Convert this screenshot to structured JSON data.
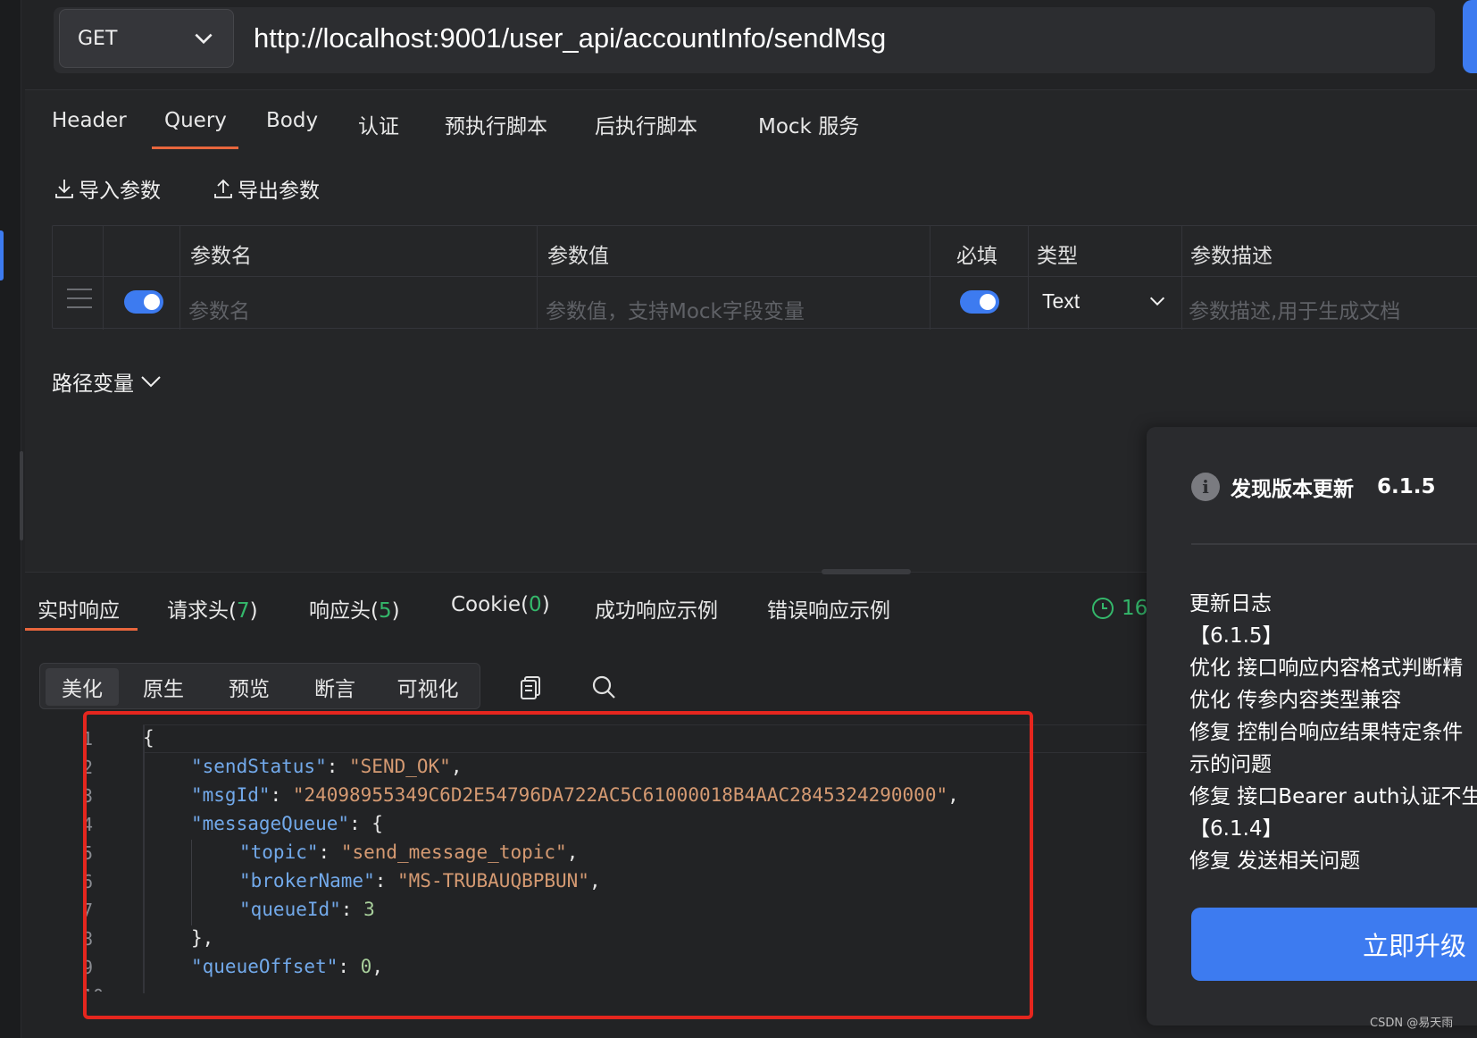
{
  "request": {
    "method": "GET",
    "url": "http://localhost:9001/user_api/accountInfo/sendMsg"
  },
  "request_tabs": [
    {
      "label": "Header"
    },
    {
      "label": "Query",
      "active": true
    },
    {
      "label": "Body"
    },
    {
      "label": "认证"
    },
    {
      "label": "预执行脚本"
    },
    {
      "label": "后执行脚本"
    },
    {
      "label": "Mock 服务"
    }
  ],
  "toolbar": {
    "import_label": "导入参数",
    "export_label": "导出参数"
  },
  "params_table": {
    "headers": {
      "name": "参数名",
      "value": "参数值",
      "required": "必填",
      "type": "类型",
      "description": "参数描述"
    },
    "row": {
      "enabled": true,
      "name_placeholder": "参数名",
      "value_placeholder": "参数值，支持Mock字段变量",
      "required": true,
      "type": "Text",
      "description_placeholder": "参数描述,用于生成文档"
    }
  },
  "path_variables_label": "路径变量",
  "response_tabs": [
    {
      "label": "实时响应",
      "count": null,
      "active": true
    },
    {
      "label": "请求头(",
      "count": "7",
      "suffix": ")"
    },
    {
      "label": "响应头(",
      "count": "5",
      "suffix": ")"
    },
    {
      "label": "Cookie(",
      "count": "0",
      "suffix": ")"
    },
    {
      "label": "成功响应示例"
    },
    {
      "label": "错误响应示例"
    }
  ],
  "response_time": "16",
  "view_modes": [
    {
      "label": "美化",
      "active": true
    },
    {
      "label": "原生"
    },
    {
      "label": "预览"
    },
    {
      "label": "断言"
    },
    {
      "label": "可视化"
    }
  ],
  "response_body": {
    "sendStatus": "SEND_OK",
    "msgId": "24098955349C6D2E54796DA722AC5C61000018B4AAC2845324290000",
    "messageQueue": {
      "topic": "send_message_topic",
      "brokerName": "MS-TRUBAUQBPBUN",
      "queueId": 3
    },
    "queueOffset": 0
  },
  "update_notice": {
    "title": "发现版本更新",
    "version": "6.1.5",
    "changelog_title": "更新日志",
    "changelog_lines": [
      "【6.1.5】",
      "优化 接口响应内容格式判断精",
      "优化 传参内容类型兼容",
      "修复 控制台响应结果特定条件",
      "示的问题",
      "修复 接口Bearer auth认证不生",
      "【6.1.4】",
      "修复 发送相关问题"
    ],
    "upgrade_label": "立即升级"
  },
  "watermark": "CSDN @易天雨",
  "colors": {
    "accent": "#3d7bf0",
    "tab_underline": "#e8663d",
    "count_green": "#34b86b",
    "highlight_box": "#e5261e"
  }
}
